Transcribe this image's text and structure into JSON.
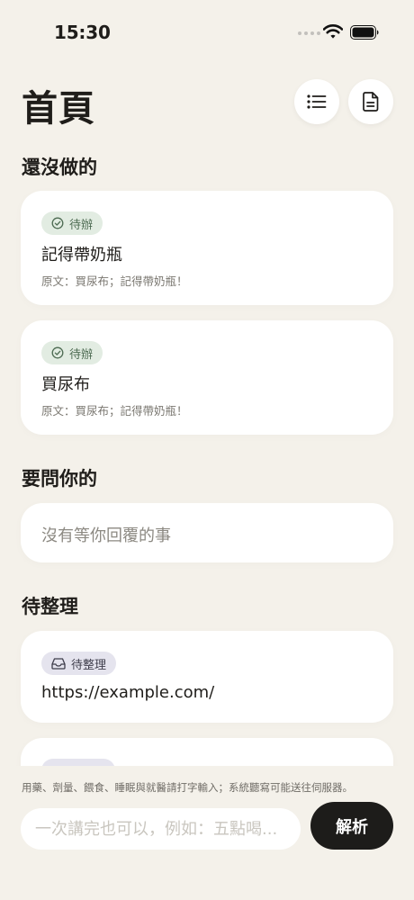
{
  "status_bar": {
    "time": "15:30"
  },
  "header": {
    "title": "首頁",
    "list_icon": "list-icon",
    "document_icon": "document-icon"
  },
  "sections": {
    "todo": {
      "title": "還沒做的",
      "items": [
        {
          "badge": "待辦",
          "badge_icon": "check-circle-icon",
          "title": "記得帶奶瓶",
          "origin": "原文：買尿布；記得帶奶瓶！"
        },
        {
          "badge": "待辦",
          "badge_icon": "check-circle-icon",
          "title": "買尿布",
          "origin": "原文：買尿布；記得帶奶瓶！"
        }
      ]
    },
    "ask": {
      "title": "要問你的",
      "empty_text": "沒有等你回覆的事"
    },
    "inbox": {
      "title": "待整理",
      "items": [
        {
          "badge": "待整理",
          "badge_icon": "inbox-tray-icon",
          "text": "https://example.com/"
        }
      ]
    }
  },
  "composer": {
    "notice": "用藥、劑量、餵食、睡眠與就醫請打字輸入；系統聽寫可能送往伺服器。",
    "placeholder": "一次講完也可以，例如：五點喝...",
    "submit_label": "解析"
  },
  "colors": {
    "background": "#f4f1ea",
    "card": "#ffffff",
    "todo_badge_bg": "#e2ece2",
    "todo_badge_text": "#4d6b52",
    "inbox_badge_bg": "#e5e4ee",
    "button_dark": "#1d1c1a"
  }
}
